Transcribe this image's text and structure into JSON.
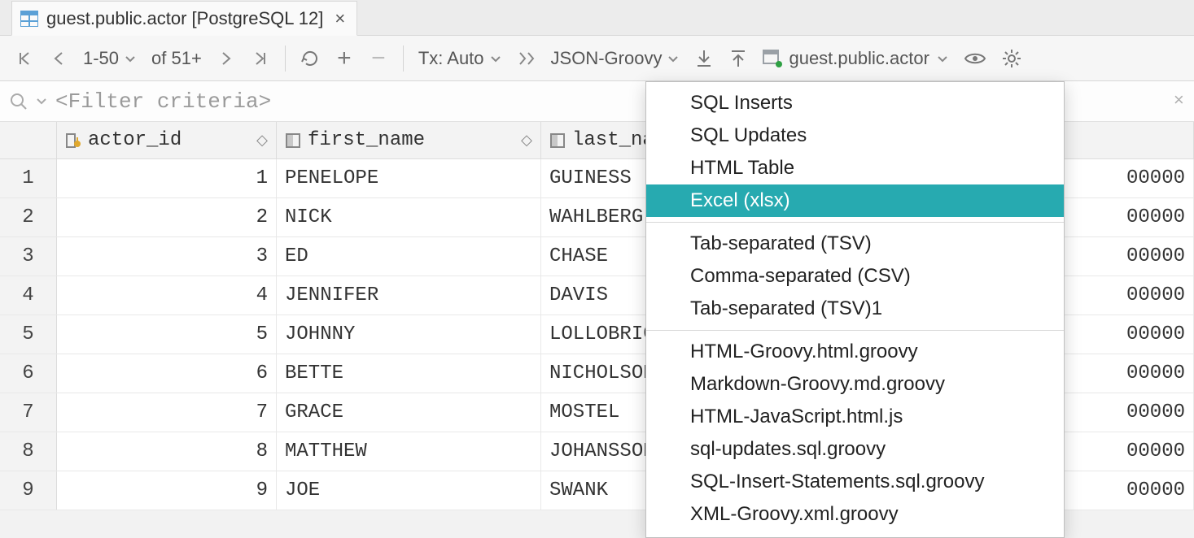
{
  "tab": {
    "title": "guest.public.actor [PostgreSQL 12]"
  },
  "toolbar": {
    "range": "1-50",
    "of": "of 51+",
    "tx": "Tx: Auto",
    "format": "JSON-Groovy",
    "table_ref": "guest.public.actor"
  },
  "filter": {
    "placeholder": "<Filter criteria>"
  },
  "columns": {
    "c1": "actor_id",
    "c2": "first_name",
    "c3": "last_name"
  },
  "rows": [
    {
      "n": "1",
      "id": "1",
      "fn": "PENELOPE",
      "ln": "GUINESS",
      "upd": "00000"
    },
    {
      "n": "2",
      "id": "2",
      "fn": "NICK",
      "ln": "WAHLBERG",
      "upd": "00000"
    },
    {
      "n": "3",
      "id": "3",
      "fn": "ED",
      "ln": "CHASE",
      "upd": "00000"
    },
    {
      "n": "4",
      "id": "4",
      "fn": "JENNIFER",
      "ln": "DAVIS",
      "upd": "00000"
    },
    {
      "n": "5",
      "id": "5",
      "fn": "JOHNNY",
      "ln": "LOLLOBRIGIDA",
      "upd": "00000"
    },
    {
      "n": "6",
      "id": "6",
      "fn": "BETTE",
      "ln": "NICHOLSON",
      "upd": "00000"
    },
    {
      "n": "7",
      "id": "7",
      "fn": "GRACE",
      "ln": "MOSTEL",
      "upd": "00000"
    },
    {
      "n": "8",
      "id": "8",
      "fn": "MATTHEW",
      "ln": "JOHANSSON",
      "upd": "00000"
    },
    {
      "n": "9",
      "id": "9",
      "fn": "JOE",
      "ln": "SWANK",
      "upd": "00000"
    }
  ],
  "menu": {
    "g1": [
      "SQL Inserts",
      "SQL Updates",
      "HTML Table",
      "Excel (xlsx)"
    ],
    "g2": [
      "Tab-separated (TSV)",
      "Comma-separated (CSV)",
      "Tab-separated (TSV)1"
    ],
    "g3": [
      "HTML-Groovy.html.groovy",
      "Markdown-Groovy.md.groovy",
      "HTML-JavaScript.html.js",
      "sql-updates.sql.groovy",
      "SQL-Insert-Statements.sql.groovy",
      "XML-Groovy.xml.groovy"
    ],
    "selected": "Excel (xlsx)"
  }
}
